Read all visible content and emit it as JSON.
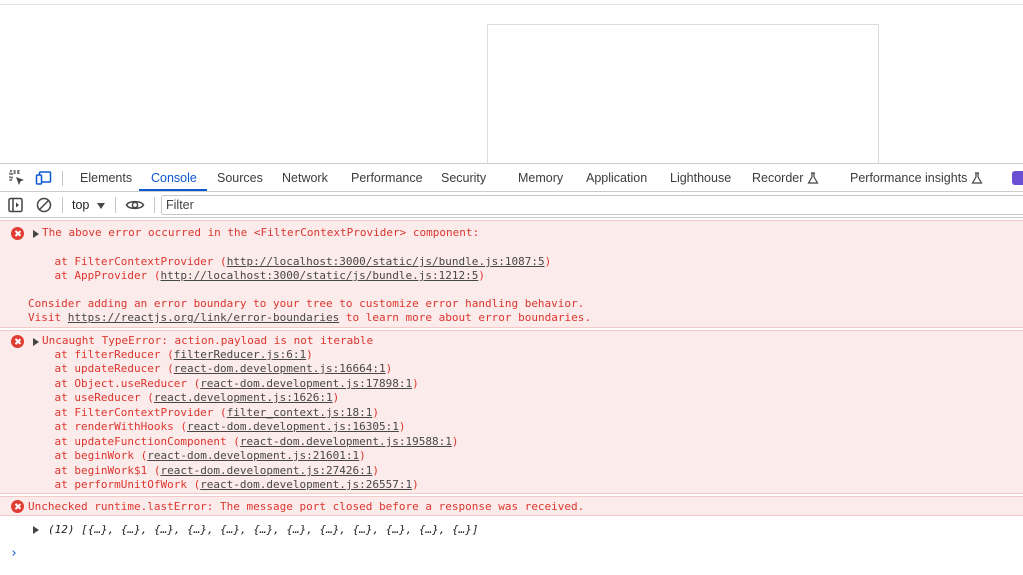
{
  "tabs": [
    "Elements",
    "Console",
    "Sources",
    "Network",
    "Performance",
    "Security",
    "Memory",
    "Application",
    "Lighthouse",
    "Recorder",
    "Performance insights"
  ],
  "active_tab": "Console",
  "toolbar": {
    "context": "top",
    "filter_placeholder": "Filter"
  },
  "messages": {
    "error1": {
      "summary": "The above error occurred in the <FilterContextProvider> component:",
      "stack": [
        {
          "prefix": "    at FilterContextProvider (",
          "link": "http://localhost:3000/static/js/bundle.js:1087:5",
          "suffix": ")"
        },
        {
          "prefix": "    at AppProvider (",
          "link": "http://localhost:3000/static/js/bundle.js:1212:5",
          "suffix": ")"
        }
      ],
      "advice_line1": "Consider adding an error boundary to your tree to customize error handling behavior.",
      "advice_line2_prefix": "Visit ",
      "advice_link": "https://reactjs.org/link/error-boundaries",
      "advice_line2_suffix": " to learn more about error boundaries."
    },
    "error2": {
      "summary": "Uncaught TypeError: action.payload is not iterable",
      "stack": [
        {
          "prefix": "    at filterReducer (",
          "link": "filterReducer.js:6:1",
          "suffix": ")"
        },
        {
          "prefix": "    at updateReducer (",
          "link": "react-dom.development.js:16664:1",
          "suffix": ")"
        },
        {
          "prefix": "    at Object.useReducer (",
          "link": "react-dom.development.js:17898:1",
          "suffix": ")"
        },
        {
          "prefix": "    at useReducer (",
          "link": "react.development.js:1626:1",
          "suffix": ")"
        },
        {
          "prefix": "    at FilterContextProvider (",
          "link": "filter_context.js:18:1",
          "suffix": ")"
        },
        {
          "prefix": "    at renderWithHooks (",
          "link": "react-dom.development.js:16305:1",
          "suffix": ")"
        },
        {
          "prefix": "    at updateFunctionComponent (",
          "link": "react-dom.development.js:19588:1",
          "suffix": ")"
        },
        {
          "prefix": "    at beginWork (",
          "link": "react-dom.development.js:21601:1",
          "suffix": ")"
        },
        {
          "prefix": "    at beginWork$1 (",
          "link": "react-dom.development.js:27426:1",
          "suffix": ")"
        },
        {
          "prefix": "    at performUnitOfWork (",
          "link": "react-dom.development.js:26557:1",
          "suffix": ")"
        }
      ]
    },
    "error3": {
      "text": "Unchecked runtime.lastError: The message port closed before a response was received."
    },
    "log": {
      "text": "(12) [{…}, {…}, {…}, {…}, {…}, {…}, {…}, {…}, {…}, {…}, {…}, {…}]"
    }
  },
  "colors": {
    "error_text": "#dc362e",
    "error_bg": "#fcebeb",
    "accent": "#0b57d0"
  }
}
